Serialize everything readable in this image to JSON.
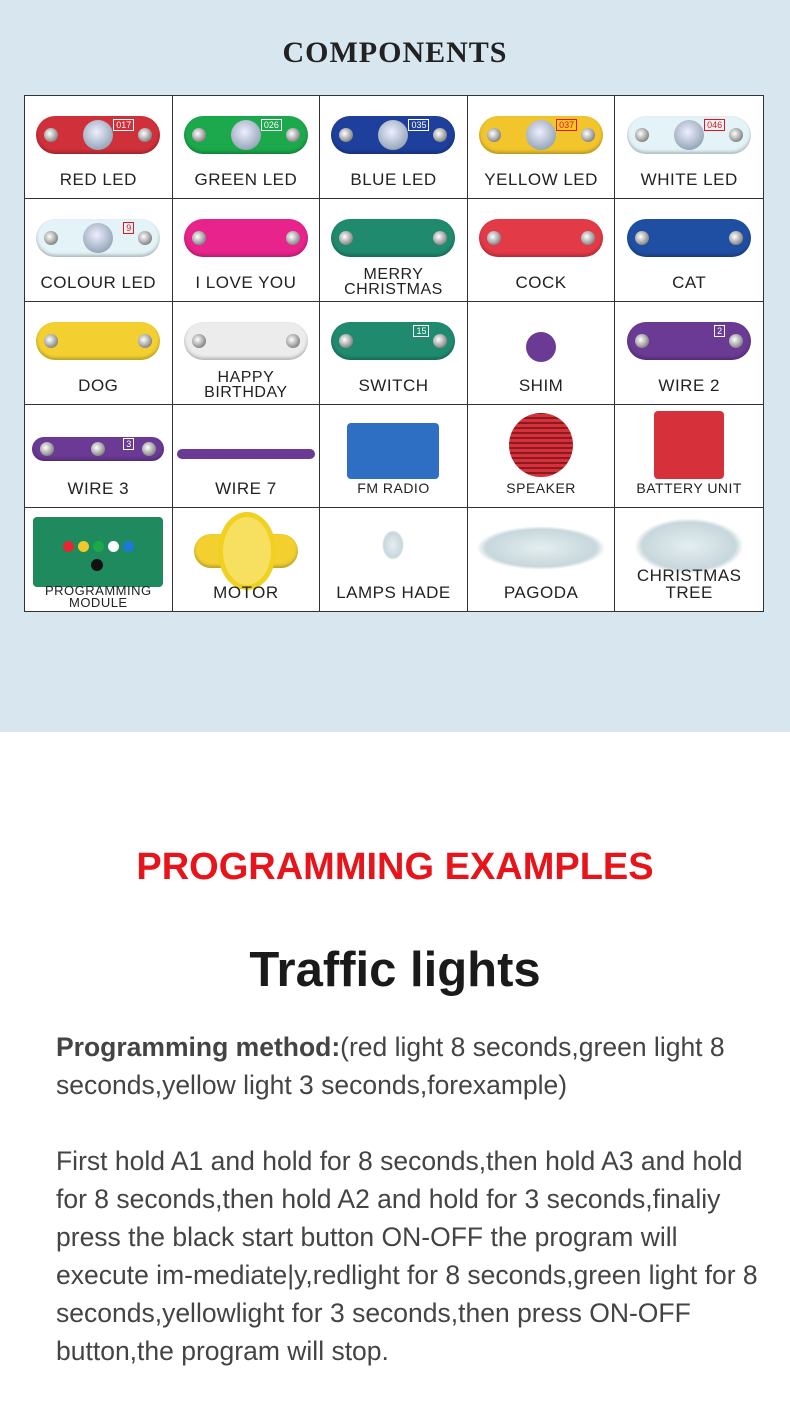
{
  "components_title": "COMPONENTS",
  "components": [
    {
      "label": "RED  LED",
      "shape": "led",
      "color": "#d0303a",
      "code": "017",
      "ink": "#fff"
    },
    {
      "label": "GREEN  LED",
      "shape": "led",
      "color": "#1ba94c",
      "code": "026",
      "ink": "#fff"
    },
    {
      "label": "BLUE  LED",
      "shape": "led",
      "color": "#1e3f9c",
      "code": "035",
      "ink": "#fff"
    },
    {
      "label": "YELLOW  LED",
      "shape": "led",
      "color": "#f2c52c",
      "code": "037",
      "ink": "#e8141b"
    },
    {
      "label": "WHITE  LED",
      "shape": "led",
      "color": "#e4f3f7",
      "code": "046",
      "ink": "#e8141b"
    },
    {
      "label": "COLOUR  LED",
      "shape": "led",
      "color": "#e4f3f7",
      "code": "9",
      "ink": "#e8141b"
    },
    {
      "label": "I  LOVE  YOU",
      "shape": "pill",
      "color": "#e8238c"
    },
    {
      "label": "MERRY\nCHRISTMAS",
      "shape": "pill",
      "color": "#1f8a6e"
    },
    {
      "label": "COCK",
      "shape": "pill",
      "color": "#e23a47"
    },
    {
      "label": "CAT",
      "shape": "pill",
      "color": "#1f4fa3"
    },
    {
      "label": "DOG",
      "shape": "pill",
      "color": "#f3d030"
    },
    {
      "label": "HAPPY\nBIRTHDAY",
      "shape": "pill",
      "color": "#ececec"
    },
    {
      "label": "SWITCH",
      "shape": "led",
      "color": "#1f8a6e",
      "code": "15",
      "ink": "#fff",
      "nolens": true
    },
    {
      "label": "SHIM",
      "shape": "dot",
      "color": "#6a3a94"
    },
    {
      "label": "WIRE 2",
      "shape": "led",
      "color": "#6a3a94",
      "code": "2",
      "ink": "#fff",
      "nolens": true
    },
    {
      "label": "WIRE 3",
      "shape": "wire3",
      "color": "#6a3a94",
      "code": "3",
      "ink": "#fff"
    },
    {
      "label": "WIRE 7",
      "shape": "thin",
      "color": "#6a3a94"
    },
    {
      "label": "FM RADIO",
      "shape": "radio",
      "color": "#2e6fc4",
      "small": true
    },
    {
      "label": "SPEAKER",
      "shape": "speaker",
      "color": "#d6303a",
      "small": true
    },
    {
      "label": "BATTERY  UNIT",
      "shape": "battery",
      "color": "#d6303a",
      "small": true
    },
    {
      "label": "PROGRAMMING\nMODULE",
      "shape": "module",
      "color": "#1e8a5e",
      "xs": true
    },
    {
      "label": "MOTOR",
      "shape": "motor",
      "color": "#f3d030"
    },
    {
      "label": "LAMPS  HADE",
      "shape": "lamp",
      "color": "#d6e6e8"
    },
    {
      "label": "PAGODA",
      "shape": "pagoda",
      "color": "#d6e6ee"
    },
    {
      "label": "CHRISTMAS  TREE",
      "shape": "tree",
      "color": "#e8eef0"
    }
  ],
  "section_title": "PROGRAMMING EXAMPLES",
  "example_title": "Traffic lights",
  "method_label": "Programming method:",
  "method_text": "(red light 8 seconds,green light 8 seconds,yellow light 3 seconds,forexample)",
  "instructions": "First hold A1 and hold for 8 seconds,then hold A3 and hold for 8 seconds,then hold A2 and hold for 3 seconds,finaliy press the black start button ON-OFF the program will execute im-mediate|y,redlight for 8 seconds,green light for 8 seconds,yellowlight for 3 seconds,then press ON-OFF button,the program will stop.",
  "colors": {
    "background_top": "#d8e6f0",
    "accent": "#e8141b",
    "text": "#444444"
  }
}
